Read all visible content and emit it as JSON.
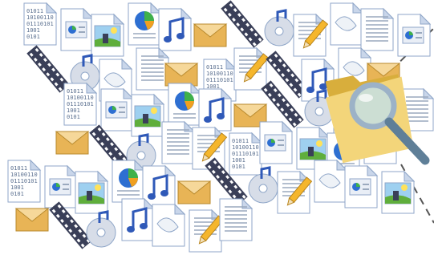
{
  "colors": {
    "page": "#ffffff",
    "page_fold": "#c9d6ea",
    "page_outline": "#8fa6c8",
    "text_lines": "#9aa9be",
    "binary_text": "#5a6f8f",
    "envelope": "#e8b456",
    "envelope_flap": "#f6d89a",
    "film": "#3a3f58",
    "film_hole": "#ffffff",
    "music_note": "#2f59b8",
    "cd": "#d7dde8",
    "pie_green": "#40b14a",
    "pie_blue": "#2e6fd1",
    "pie_orange": "#f0a020",
    "pencil": "#f5b62c",
    "photo_sky": "#9ed0f0",
    "photo_grass": "#5fae3c",
    "folder": "#f3d57a",
    "folder_dark": "#d8ae3c",
    "magnifier_rim": "#9cb2c7",
    "magnifier_glass": "#bfe0f2",
    "magnifier_handle": "#5f7f98",
    "dash_line": "#555555"
  },
  "binary_lines": [
    "01011",
    "10100110",
    "01110101",
    "1001",
    "0101"
  ],
  "icons": [
    {
      "kind": "binary"
    },
    {
      "kind": "presentation"
    },
    {
      "kind": "photo"
    },
    {
      "kind": "chart"
    },
    {
      "kind": "music"
    },
    {
      "kind": "envelope"
    },
    {
      "kind": "film"
    },
    {
      "kind": "cd"
    },
    {
      "kind": "text"
    },
    {
      "kind": "pencil"
    },
    {
      "kind": "blank"
    }
  ],
  "decorations": {
    "folder": "folder-search",
    "dashed_lines": 2
  }
}
